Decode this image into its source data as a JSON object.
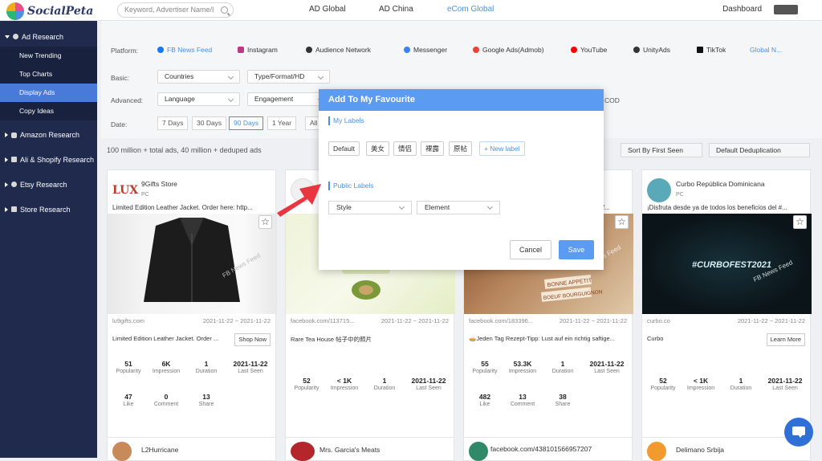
{
  "app": {
    "name": "SocialPeta"
  },
  "search": {
    "placeholder": "Keyword, Advertiser Name/I"
  },
  "topnav": {
    "items": [
      "AD Global",
      "AD China",
      "eCom Global"
    ],
    "active": "eCom Global",
    "dashboard": "Dashboard"
  },
  "sidebar": {
    "ad_research": "Ad Research",
    "sub": [
      "New Trending",
      "Top Charts",
      "Display Ads",
      "Copy Ideas"
    ],
    "active": "Display Ads",
    "sections": [
      "Amazon Research",
      "Ali & Shopify Research",
      "Etsy Research",
      "Store Research"
    ]
  },
  "filters": {
    "platform_label": "Platform:",
    "platforms": [
      "FB News Feed",
      "Instagram",
      "Audience Network",
      "Messenger",
      "Google Ads(Admob)",
      "YouTube",
      "UnityAds",
      "TikTok",
      "Global N..."
    ],
    "platform_colors": [
      "#1877f2",
      "#c13584",
      "#333333",
      "#3b82f6",
      "#ea4335",
      "#ff0000",
      "#333333",
      "#111111",
      "#4a90e2"
    ],
    "basic_label": "Basic:",
    "basic": [
      "Countries",
      "Type/Format/HD"
    ],
    "advanced_label": "Advanced:",
    "advanced": [
      "Language",
      "Engagement"
    ],
    "cod": "COD",
    "date_label": "Date:",
    "dates": [
      "7 Days",
      "30 Days",
      "90 Days",
      "1 Year",
      "All"
    ],
    "date_active": "90 Days"
  },
  "summary": "100 million + total ads, 40 million + deduped ads",
  "sort": {
    "sort_by": "Sort By First Seen",
    "dedup": "Default Deduplication"
  },
  "cards": [
    {
      "title": "9Gifts Store",
      "platform": "PC",
      "text": "Limited Edition Leather Jacket. Order here: http...",
      "url": "lu9gifts.com",
      "date": "2021-11-22 ~ 2021-11-22",
      "desc": "Limited Edition Leather Jacket. Order ...",
      "cta": "Shop Now",
      "watermark": "FB News Feed",
      "stats1": [
        {
          "v": "51",
          "l": "Popularity"
        },
        {
          "v": "6K",
          "l": "Impression"
        },
        {
          "v": "1",
          "l": "Duration"
        },
        {
          "v": "2021-11-22",
          "l": "Last Seen"
        }
      ],
      "stats2": [
        {
          "v": "47",
          "l": "Like"
        },
        {
          "v": "0",
          "l": "Comment"
        },
        {
          "v": "13",
          "l": "Share"
        }
      ]
    },
    {
      "title": "",
      "platform": "PC",
      "text": "",
      "url": "facebook.com/113715...",
      "date": "2021-11-22 ~ 2021-11-22",
      "desc": "Rare Tea House 帖子中的照片",
      "cta": "",
      "watermark": "",
      "stats1": [
        {
          "v": "52",
          "l": "Popularity"
        },
        {
          "v": "< 1K",
          "l": "Impression"
        },
        {
          "v": "1",
          "l": "Duration"
        },
        {
          "v": "2021-11-22",
          "l": "Last Seen"
        }
      ],
      "stats2": []
    },
    {
      "title": "",
      "platform": "PC",
      "text": "...jeden Tag Rezept-Tipp: Lust auf ein richtig saf...",
      "url": "facebook.com/183396...",
      "date": "2021-11-22 ~ 2021-11-22",
      "desc": "🥧Jeden Tag Rezept-Tipp: Lust auf ein richtig saftige...",
      "cta": "",
      "watermark": "FB News Feed",
      "stats1": [
        {
          "v": "55",
          "l": "Popularity"
        },
        {
          "v": "53.3K",
          "l": "Impression"
        },
        {
          "v": "1",
          "l": "Duration"
        },
        {
          "v": "2021-11-22",
          "l": "Last Seen"
        }
      ],
      "stats2": [
        {
          "v": "482",
          "l": "Like"
        },
        {
          "v": "13",
          "l": "Comment"
        },
        {
          "v": "38",
          "l": "Share"
        }
      ]
    },
    {
      "title": "Curbo República Dominicana",
      "platform": "PC",
      "text": "¡Disfruta desde ya de todos los beneficios del #...",
      "url": "curbo.co",
      "date": "2021-11-22 ~ 2021-11-22",
      "desc": "Curbo",
      "cta": "Learn More",
      "watermark": "FB News Feed",
      "img_text": "#CURBOFEST2021",
      "stats1": [
        {
          "v": "52",
          "l": "Popularity"
        },
        {
          "v": "< 1K",
          "l": "Impression"
        },
        {
          "v": "1",
          "l": "Duration"
        },
        {
          "v": "2021-11-22",
          "l": "Last Seen"
        }
      ],
      "stats2": []
    }
  ],
  "card3_img_text": [
    "BONNE APPETIT",
    "BOEUF BOURGUIGNON"
  ],
  "card1_logo": "LUX",
  "next_row": [
    "L2Hurricane",
    "Mrs. Garcia's Meats",
    "facebook.com/438101566957207",
    "Delimano Srbija"
  ],
  "dialog": {
    "title": "Add To My Favourite",
    "my_labels": "My Labels",
    "tags": [
      "Default",
      "美女",
      "情侣",
      "裸露",
      "原帖"
    ],
    "new_label": "+ New label",
    "public_labels": "Public Labels",
    "public_selects": [
      "Style",
      "Element"
    ],
    "cancel": "Cancel",
    "save": "Save"
  }
}
